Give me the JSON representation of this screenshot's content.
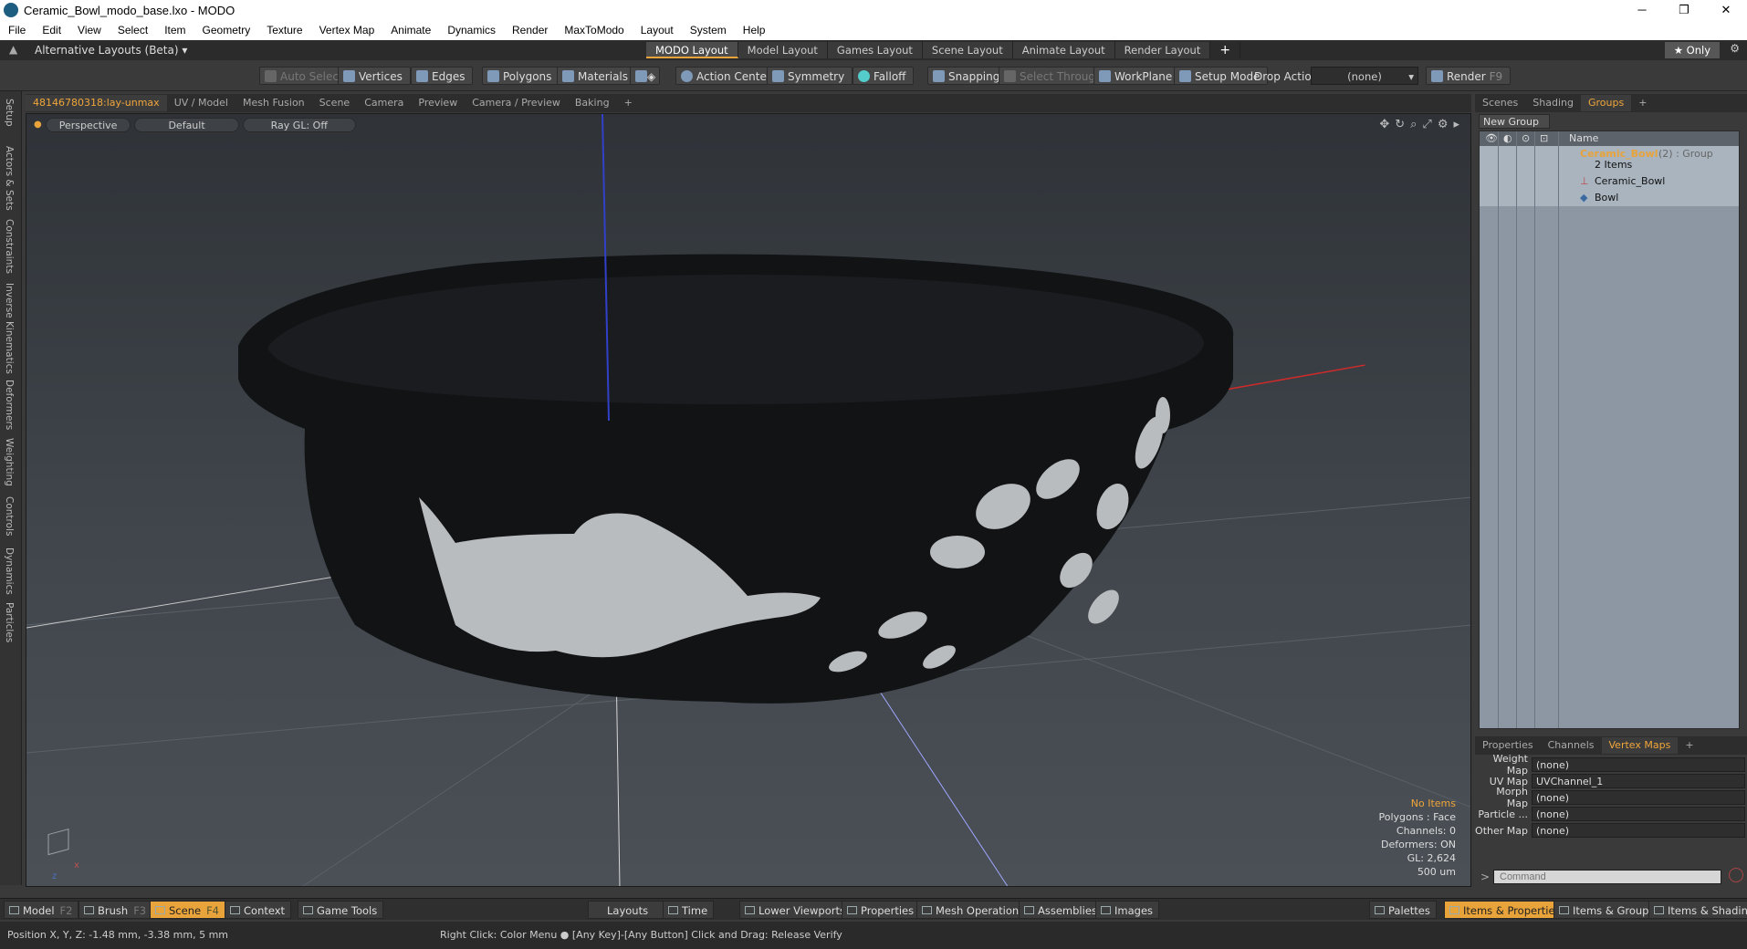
{
  "window": {
    "title": "Ceramic_Bowl_modo_base.lxo - MODO",
    "controls": [
      "─",
      "❐",
      "✕"
    ]
  },
  "menu": [
    "File",
    "Edit",
    "View",
    "Select",
    "Item",
    "Geometry",
    "Texture",
    "Vertex Map",
    "Animate",
    "Dynamics",
    "Render",
    "MaxToModo",
    "Layout",
    "System",
    "Help"
  ],
  "layoutbar": {
    "alt_layouts": "Alternative Layouts (Beta) ▾",
    "tabs": [
      "MODO Layout",
      "Model Layout",
      "Games Layout",
      "Scene Layout",
      "Animate Layout",
      "Render Layout"
    ],
    "active_tab": "MODO Layout",
    "add": "+",
    "only": "★  Only"
  },
  "toolbar": {
    "auto_select": "Auto Select",
    "vertices": "Vertices",
    "edges": "Edges",
    "polygons": "Polygons",
    "materials": "Materials",
    "action_center": "Action Center",
    "symmetry": "Symmetry",
    "falloff": "Falloff",
    "snapping": "Snapping",
    "select_through": "Select Through",
    "workplane": "WorkPlane",
    "setup_mode": "Setup Mode",
    "drop_action_label": "Drop Action",
    "drop_action_value": "(none)",
    "render": "Render",
    "render_key": "F9"
  },
  "left_tabs": [
    "Setup",
    "Actors & Sets",
    "Constraints",
    "Inverse Kinematics",
    "Deformers",
    "Weighting",
    "Controls",
    "Dynamics",
    "Particles"
  ],
  "viewport_tabs": [
    "48146780318:lay-unmax",
    "UV / Model",
    "Mesh Fusion",
    "Scene",
    "Camera",
    "Preview",
    "Camera / Preview",
    "Baking",
    "+"
  ],
  "viewport": {
    "view": "Perspective",
    "shading": "Default",
    "raygl": "Ray GL: Off",
    "info": {
      "no_items": "No Items",
      "polygons": "Polygons : Face",
      "channels": "Channels: 0",
      "deformers": "Deformers: ON",
      "gl": "GL: 2,624",
      "scale": "500 um"
    }
  },
  "right_panel": {
    "tabs": [
      "Scenes",
      "Shading",
      "Groups",
      "+"
    ],
    "active_tab": "Groups",
    "new_group": "New Group",
    "col_name": "Name",
    "group_name": "Ceramic_Bowl",
    "group_suffix": " (2) : Group",
    "group_count": "2 Items",
    "children": [
      "Ceramic_Bowl",
      "Bowl"
    ],
    "props_tabs": [
      "Properties",
      "Channels",
      "Vertex Maps",
      "+"
    ],
    "props_active": "Vertex Maps",
    "props": [
      {
        "label": "Weight Map",
        "value": "(none)"
      },
      {
        "label": "UV Map",
        "value": "UVChannel_1"
      },
      {
        "label": "Morph Map",
        "value": "(none)"
      },
      {
        "label": "Particle ...",
        "value": "(none)"
      },
      {
        "label": "Other Map",
        "value": "(none)"
      }
    ],
    "command_placeholder": "Command"
  },
  "bottom": {
    "model": "Model",
    "model_key": "F2",
    "brush": "Brush",
    "brush_key": "F3",
    "scene": "Scene",
    "scene_key": "F4",
    "context": "Context",
    "game_tools": "Game Tools",
    "layouts": "Layouts",
    "time": "Time",
    "lower_viewports": "Lower Viewports",
    "properties": "Properties",
    "mesh_operations": "Mesh Operations",
    "assemblies": "Assemblies",
    "images": "Images",
    "palettes": "Palettes",
    "items_properties": "Items & Properties",
    "items_groups": "Items & Groups",
    "items_shading": "Items & Shading"
  },
  "status": {
    "position": "Position X, Y, Z:   -1.48 mm, -3.38 mm, 5 mm",
    "hint": "Right Click: Color Menu ●  [Any Key]-[Any Button] Click and Drag: Release Verify"
  },
  "colors": {
    "accent": "#e8a33a",
    "bowl": "#141517",
    "decal": "#b9bcbf"
  }
}
